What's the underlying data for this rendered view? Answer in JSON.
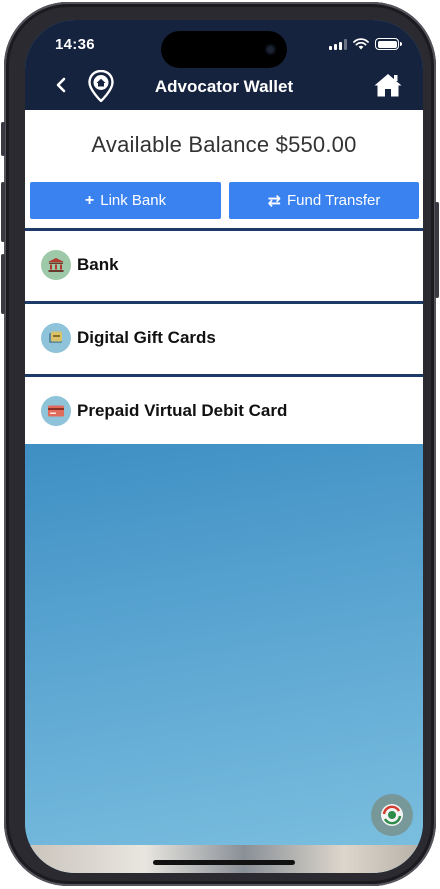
{
  "status": {
    "time": "14:36"
  },
  "nav": {
    "title": "Advocator Wallet",
    "back_icon": "chevron-left-icon",
    "logo_icon": "location-pin-home-icon",
    "home_icon": "home-icon"
  },
  "wallet": {
    "balance_text": "Available Balance $550.00"
  },
  "actions": {
    "link_bank": {
      "icon": "+",
      "label": "Link Bank"
    },
    "fund_transfer": {
      "icon": "⇄",
      "label": "Fund Transfer"
    }
  },
  "items": [
    {
      "label": "Bank",
      "icon": "bank-icon"
    },
    {
      "label": "Digital Gift Cards",
      "icon": "gift-card-icon"
    },
    {
      "label": "Prepaid Virtual Debit Card",
      "icon": "debit-card-icon"
    }
  ],
  "colors": {
    "nav_bg": "#16233f",
    "button_bg": "#3b82f1",
    "divider": "#1e3a66"
  }
}
